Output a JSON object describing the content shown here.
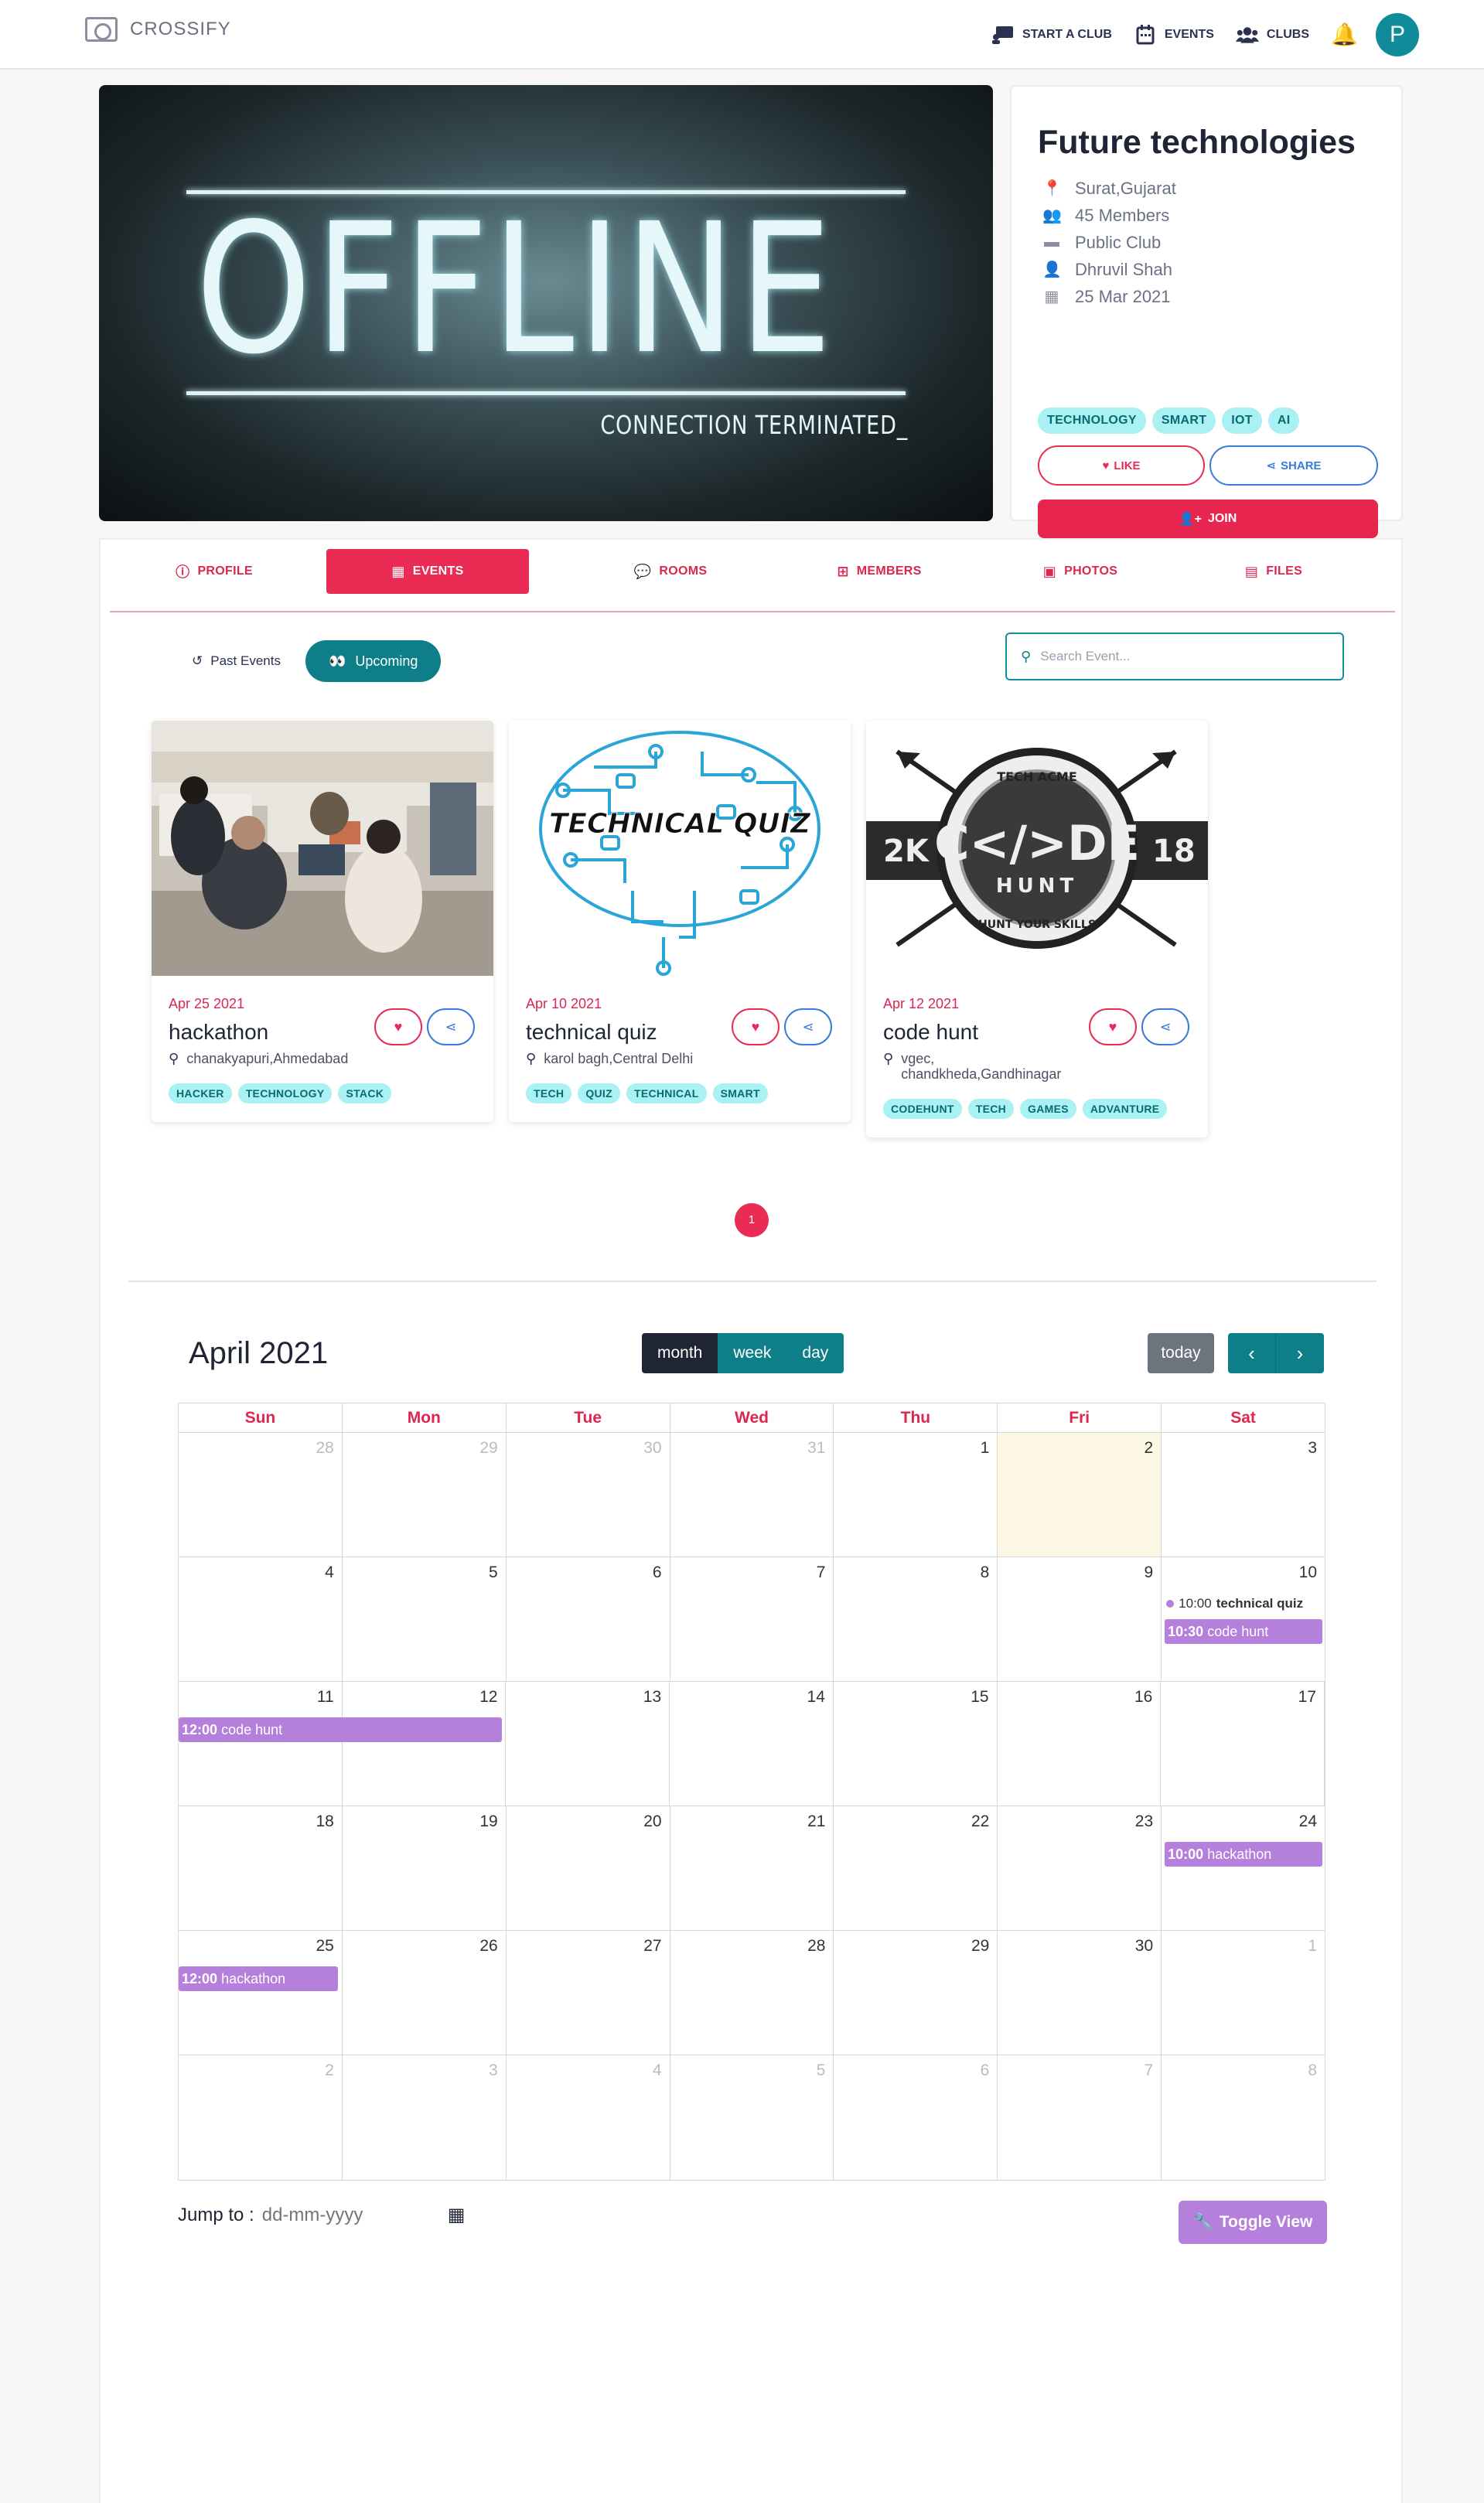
{
  "nav": {
    "brand": "CROSSIFY",
    "start_club": "START A CLUB",
    "events": "EVENTS",
    "clubs": "CLUBS",
    "avatar_letter": "P"
  },
  "banner": {
    "big_text": "OFFLINE",
    "sub_text": "CONNECTION TERMINATED_"
  },
  "club": {
    "name": "Future technologies",
    "location": "Surat,Gujarat",
    "members": "45 Members",
    "type": "Public Club",
    "owner": "Dhruvil Shah",
    "created": "25 Mar 2021",
    "tags": [
      "TECHNOLOGY",
      "SMART",
      "IOT",
      "AI"
    ],
    "like_label": "LIKE",
    "share_label": "SHARE",
    "join_label": "JOIN"
  },
  "tabs": [
    "PROFILE",
    "EVENTS",
    "ROOMS",
    "MEMBERS",
    "PHOTOS",
    "FILES"
  ],
  "events_section": {
    "past_label": "Past Events",
    "upcoming_label": "Upcoming",
    "search_placeholder": "Search Event..."
  },
  "event_cards": [
    {
      "date": "Apr 25 2021",
      "title": "hackathon",
      "location": "chanakyapuri,Ahmedabad",
      "tags": [
        "HACKER",
        "TECHNOLOGY",
        "STACK"
      ]
    },
    {
      "date": "Apr 10 2021",
      "title": "technical quiz",
      "location": "karol bagh,Central Delhi",
      "tags": [
        "TECH",
        "QUIZ",
        "TECHNICAL",
        "SMART"
      ],
      "image_text": "TECHNICAL QUIZ"
    },
    {
      "date": "Apr 12 2021",
      "title": "code hunt",
      "location_line1": "vgec,",
      "location_line2": "chandkheda,Gandhinagar",
      "tags": [
        "CODEHUNT",
        "TECH",
        "GAMES",
        "ADVANTURE"
      ],
      "image_text": "C</>DE",
      "image_sub": "HUNT",
      "image_top": "TECH ACME",
      "image_bottom": "HUNT YOUR SKILLS",
      "image_left": "2K",
      "image_right": "18"
    }
  ],
  "pagination": {
    "current": "1"
  },
  "calendar": {
    "title": "April 2021",
    "views": [
      "month",
      "week",
      "day"
    ],
    "today_label": "today",
    "prev_icon": "‹",
    "next_icon": "›",
    "weekdays": [
      "Sun",
      "Mon",
      "Tue",
      "Wed",
      "Thu",
      "Fri",
      "Sat"
    ],
    "weeks": [
      [
        "28",
        "29",
        "30",
        "31",
        "1",
        "2",
        "3"
      ],
      [
        "4",
        "5",
        "6",
        "7",
        "8",
        "9",
        "10"
      ],
      [
        "11",
        "12",
        "13",
        "14",
        "15",
        "16",
        "17"
      ],
      [
        "18",
        "19",
        "20",
        "21",
        "22",
        "23",
        "24"
      ],
      [
        "25",
        "26",
        "27",
        "28",
        "29",
        "30",
        "1"
      ],
      [
        "2",
        "3",
        "4",
        "5",
        "6",
        "7",
        "8"
      ]
    ],
    "events": {
      "tq_time": "10:00",
      "tq_title": "technical quiz",
      "ch1_time": "10:30",
      "ch1_title": "code hunt",
      "ch2_time": "12:00",
      "ch2_title": "code hunt",
      "hk1_time": "10:00",
      "hk1_title": "hackathon",
      "hk2_time": "12:00",
      "hk2_title": "hackathon"
    },
    "jump_label": "Jump to :",
    "jump_placeholder": "dd-mm-yyyy",
    "toggle_label": "Toggle View"
  },
  "colors": {
    "accent": "#ea2b54",
    "teal": "#0e7f89",
    "event": "#b57fdc"
  }
}
